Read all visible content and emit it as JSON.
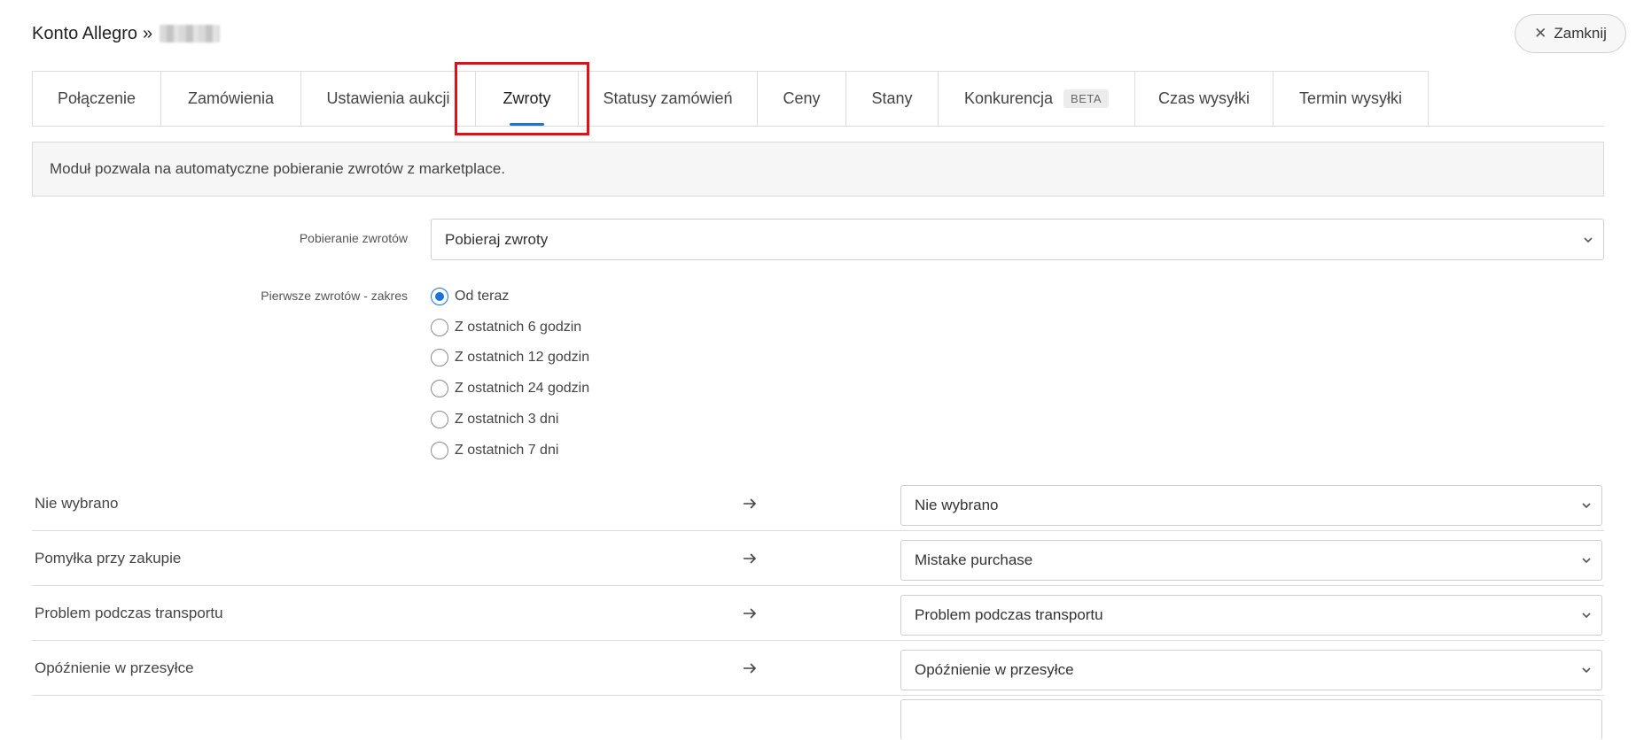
{
  "header": {
    "title": "Konto Allegro",
    "separator": "»",
    "close_label": "Zamknij"
  },
  "tabs": [
    {
      "label": "Połączenie"
    },
    {
      "label": "Zamówienia"
    },
    {
      "label": "Ustawienia aukcji"
    },
    {
      "label": "Zwroty",
      "active": true
    },
    {
      "label": "Statusy zamówień"
    },
    {
      "label": "Ceny"
    },
    {
      "label": "Stany"
    },
    {
      "label": "Konkurencja",
      "badge": "BETA"
    },
    {
      "label": "Czas wysyłki"
    },
    {
      "label": "Termin wysyłki"
    }
  ],
  "info": {
    "text": "Moduł pozwala na automatyczne pobieranie zwrotów z marketplace."
  },
  "form": {
    "download_label": "Pobieranie zwrotów",
    "download_value": "Pobieraj zwroty",
    "range_label": "Pierwsze zwrotów - zakres",
    "range_options": [
      {
        "label": "Od teraz",
        "checked": true
      },
      {
        "label": "Z ostatnich 6 godzin"
      },
      {
        "label": "Z ostatnich 12 godzin"
      },
      {
        "label": "Z ostatnich 24 godzin"
      },
      {
        "label": "Z ostatnich 3 dni"
      },
      {
        "label": "Z ostatnich 7 dni"
      }
    ]
  },
  "mappings": [
    {
      "source": "Nie wybrano",
      "target": "Nie wybrano"
    },
    {
      "source": "Pomyłka przy zakupie",
      "target": "Mistake purchase"
    },
    {
      "source": "Problem podczas transportu",
      "target": "Problem podczas transportu"
    },
    {
      "source": "Opóźnienie w przesyłce",
      "target": "Opóźnienie w przesyłce"
    }
  ],
  "colors": {
    "accent": "#1a73d9",
    "highlight": "#e0101a"
  },
  "icons": {
    "close": "close-icon",
    "chevron": "chevron-down-icon",
    "arrow": "arrow-right-icon"
  }
}
